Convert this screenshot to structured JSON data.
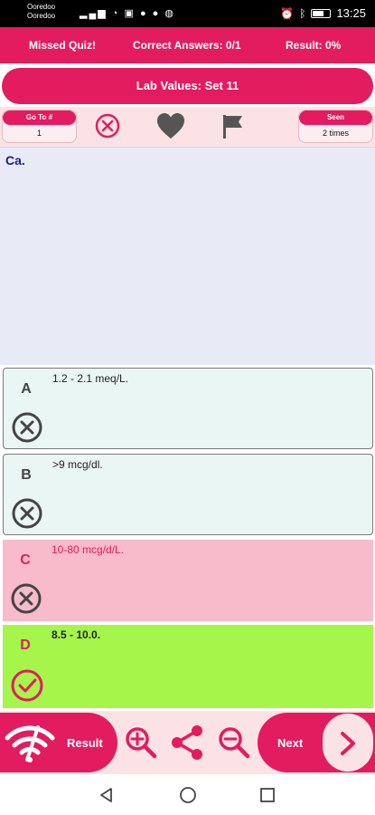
{
  "status_bar": {
    "carrier_1": "Ooredoo",
    "carrier_2": "Ooredoo",
    "time": "13:25"
  },
  "top_bar": {
    "quiz_type": "Missed Quiz!",
    "correct_answers": "Correct Answers: 0/1",
    "result": "Result: 0%"
  },
  "set_title": "Lab Values: Set 11",
  "controls": {
    "goto_label": "Go To #",
    "goto_value": "1",
    "seen_label": "Seen",
    "seen_value": "2 times",
    "icons": [
      "cancel-icon",
      "heart-icon",
      "flag-icon"
    ]
  },
  "question": {
    "text": "Ca."
  },
  "options": [
    {
      "letter": "A",
      "text": "1.2 - 2.1 meq/L.",
      "state": "incorrect"
    },
    {
      "letter": "B",
      "text": ">9 mcg/dl.",
      "state": "incorrect"
    },
    {
      "letter": "C",
      "text": "10-80 mcg/d/L.",
      "state": "selected-wrong"
    },
    {
      "letter": "D",
      "text": "8.5 - 10.0.",
      "state": "correct"
    }
  ],
  "bottom_bar": {
    "result_label": "Result",
    "next_label": "Next",
    "icons": [
      "no-signal-icon",
      "zoom-in-icon",
      "share-icon",
      "zoom-out-icon",
      "chevron-right-icon"
    ]
  },
  "colors": {
    "accent": "#e31c5f",
    "option_default_bg": "#eaf6f3",
    "option_wrong_bg": "#f8bbcb",
    "option_correct_bg": "#a6f54b",
    "question_bg": "#e8eaf6"
  }
}
